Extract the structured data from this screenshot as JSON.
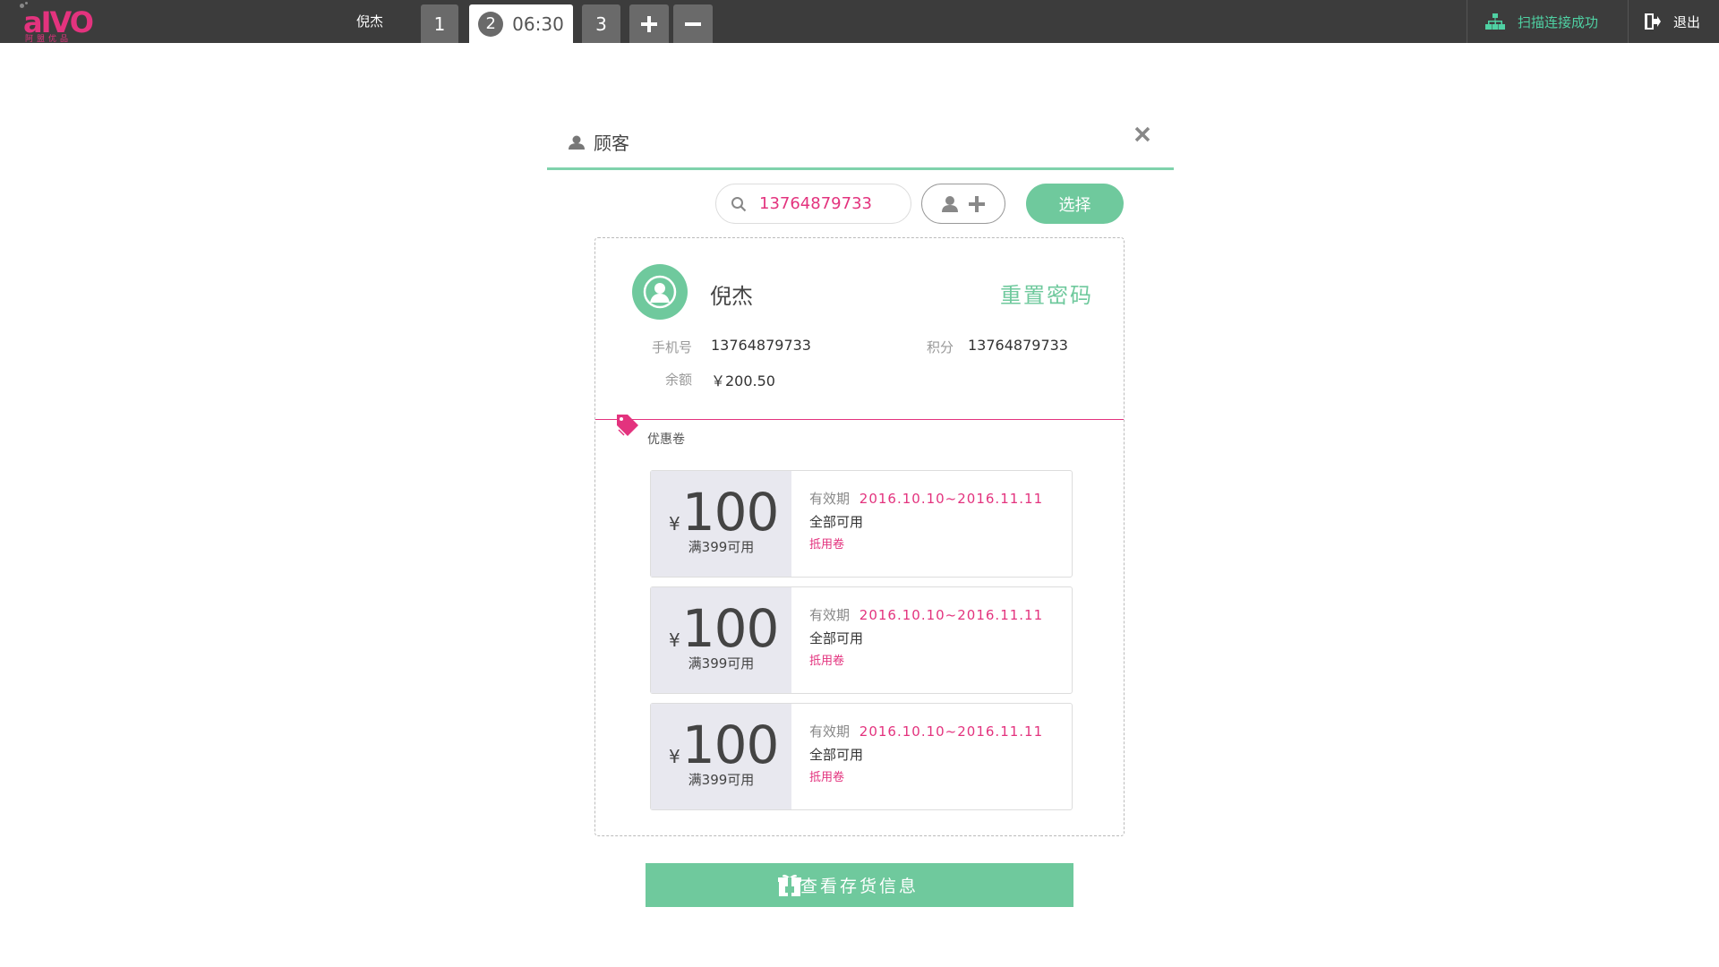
{
  "topbar": {
    "logo_text": "aIVO",
    "logo_sub": "阿盟优品",
    "user_name": "倪杰",
    "tabs": [
      {
        "label": "1"
      },
      {
        "number": "2",
        "time": "06:30"
      },
      {
        "label": "3"
      }
    ],
    "add_tab_icon": "plus-icon",
    "remove_tab_icon": "minus-icon",
    "scan_status": "扫描连接成功",
    "logout_label": "退出"
  },
  "dialog": {
    "title": "顾客",
    "search": {
      "value": "13764879733",
      "placeholder": ""
    },
    "select_label": "选择",
    "member": {
      "name": "倪杰",
      "reset_password": "重置密码",
      "phone_label": "手机号",
      "phone": "13764879733",
      "points_label": "积分",
      "points": "13764879733",
      "balance_label": "余额",
      "balance": "￥200.50"
    },
    "coupons_title": "优惠卷",
    "coupons": [
      {
        "currency": "¥",
        "amount": "100",
        "condition": "满399可用",
        "validity_label": "有效期",
        "validity": "2016.10.10~2016.11.11",
        "scope": "全部可用",
        "type": "抵用卷"
      },
      {
        "currency": "¥",
        "amount": "100",
        "condition": "满399可用",
        "validity_label": "有效期",
        "validity": "2016.10.10~2016.11.11",
        "scope": "全部可用",
        "type": "抵用卷"
      },
      {
        "currency": "¥",
        "amount": "100",
        "condition": "满399可用",
        "validity_label": "有效期",
        "validity": "2016.10.10~2016.11.11",
        "scope": "全部可用",
        "type": "抵用卷"
      }
    ],
    "stock_button": "查看存货信息"
  },
  "colors": {
    "accent_green": "#6fc99d",
    "accent_pink": "#e3337e",
    "topbar_bg": "#3c3c3c",
    "scan_green": "#4fd1a3"
  }
}
